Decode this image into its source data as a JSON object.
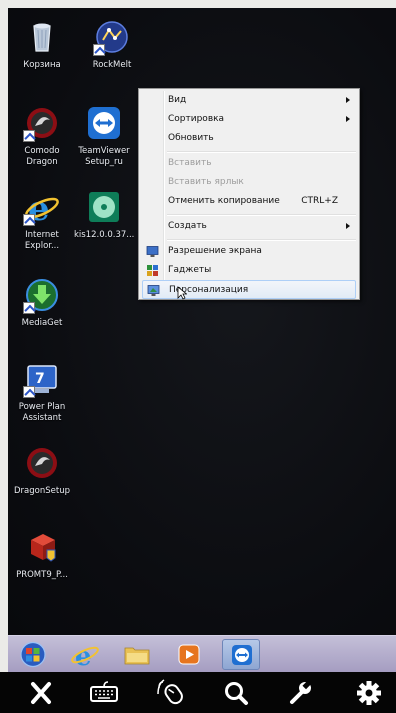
{
  "desktop": {
    "icons": [
      {
        "id": "recycle",
        "label": "Корзина",
        "icon": "recycle-bin-icon"
      },
      {
        "id": "rockmelt",
        "label": "RockMelt",
        "icon": "rockmelt-icon"
      },
      {
        "id": "comodo",
        "label": "Comodo Dragon",
        "icon": "comodo-dragon-icon"
      },
      {
        "id": "teamviewer",
        "label": "TeamViewer Setup_ru",
        "icon": "teamviewer-icon"
      },
      {
        "id": "ie",
        "label": "Internet Explor...",
        "icon": "internet-explorer-icon"
      },
      {
        "id": "kis",
        "label": "kis12.0.0.37...",
        "icon": "disc-installer-icon"
      },
      {
        "id": "mediaget",
        "label": "MediaGet",
        "icon": "mediaget-icon"
      },
      {
        "id": "powerplan",
        "label": "Power Plan Assistant",
        "icon": "power-plan-icon"
      },
      {
        "id": "dragonsetup",
        "label": "DragonSetup",
        "icon": "dragon-setup-icon"
      },
      {
        "id": "promt",
        "label": "PROMT9_P...",
        "icon": "promt-setup-icon"
      }
    ]
  },
  "context_menu": {
    "items": {
      "view": "Вид",
      "sort": "Сортировка",
      "refresh": "Обновить",
      "paste": "Вставить",
      "paste_shortcut": "Вставить ярлык",
      "undo_copy": "Отменить копирование",
      "undo_copy_shortcut": "CTRL+Z",
      "create": "Создать",
      "resolution": "Разрешение экрана",
      "gadgets": "Гаджеты",
      "personalize": "Персонализация"
    }
  },
  "taskbar": {
    "items": [
      "start-orb-icon",
      "internet-explorer-icon",
      "explorer-folder-icon",
      "media-player-icon",
      "teamviewer-icon"
    ]
  },
  "control_bar": {
    "buttons": [
      "close-icon",
      "keyboard-icon",
      "mouse-icon",
      "search-icon",
      "wrench-icon",
      "gear-icon"
    ]
  }
}
